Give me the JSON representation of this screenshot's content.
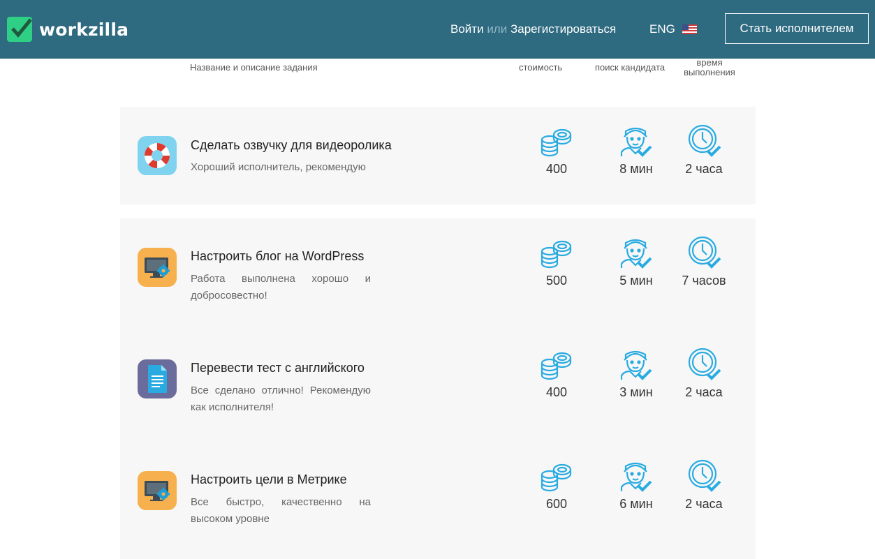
{
  "header": {
    "logo_text": "workzilla",
    "login_label": "Войти",
    "or_label": "или",
    "register_label": "Зарегистироваться",
    "lang_label": "ENG",
    "become_button": "Стать исполнителем"
  },
  "columns": {
    "name": "Название и описание задания",
    "cost": "стоимость",
    "search": "поиск кандидата",
    "time": "время выполнения"
  },
  "tasks": [
    {
      "title": "Сделать озвучку для видеоролика",
      "desc": "Хороший исполнитель, рекомендую",
      "cost": "400",
      "search": "8 мин",
      "time": "2 часа",
      "icon": "lifebuoy-icon"
    },
    {
      "title": "Настроить блог на WordPress",
      "desc": "Работа выполнена хорошо и добросовестно!",
      "cost": "500",
      "search": "5 мин",
      "time": "7 часов",
      "icon": "monitor-gear-icon"
    },
    {
      "title": "Перевести тест с английского",
      "desc": "Все сделано отлично! Рекомендую как исполнителя!",
      "cost": "400",
      "search": "3 мин",
      "time": "2 часа",
      "icon": "document-icon"
    },
    {
      "title": "Настроить цели в Метрике",
      "desc": "Все быстро, качественно на высоком уровне",
      "cost": "600",
      "search": "6 мин",
      "time": "2 часа",
      "icon": "monitor-gear-icon"
    }
  ],
  "colors": {
    "header_bg": "#2e6a80",
    "accent": "#29abe2",
    "card_bg": "#f7f7f7"
  }
}
